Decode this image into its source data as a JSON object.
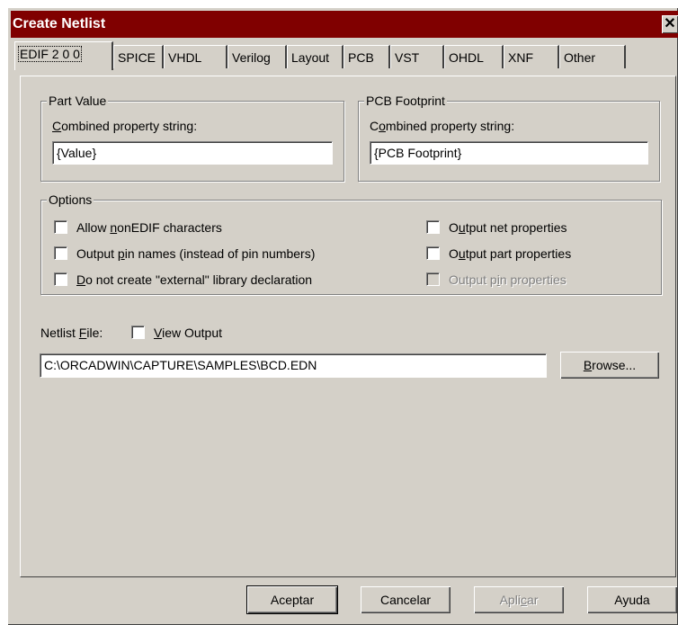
{
  "window": {
    "title": "Create Netlist",
    "close_glyph": "✕"
  },
  "tabs": [
    {
      "label": "EDIF 2 0 0",
      "active": true
    },
    {
      "label": "SPICE"
    },
    {
      "label": "VHDL"
    },
    {
      "label": "Verilog"
    },
    {
      "label": "Layout"
    },
    {
      "label": "PCB"
    },
    {
      "label": "VST"
    },
    {
      "label": "OHDL"
    },
    {
      "label": "XNF"
    },
    {
      "label": "Other"
    }
  ],
  "part_value": {
    "group_label": "Part Value",
    "field_label_u": "C",
    "field_label_rest": "ombined property string:",
    "value": "{Value}"
  },
  "pcb_footprint": {
    "group_label": "PCB Footprint",
    "field_label_pre": "C",
    "field_label_u": "o",
    "field_label_rest": "mbined property string:",
    "value": "{PCB Footprint}"
  },
  "options": {
    "group_label": "Options",
    "allow_nonedif": {
      "pre": "Allow ",
      "u": "n",
      "rest": "onEDIF characters"
    },
    "output_pin_names": {
      "pre": "Output ",
      "u": "p",
      "rest": "in names (instead of pin numbers)"
    },
    "no_external": {
      "pre": "",
      "u": "D",
      "rest": "o not create \"external\" library declaration"
    },
    "output_net": {
      "pre": "O",
      "u": "u",
      "rest": "tput net properties"
    },
    "output_part": {
      "pre": "O",
      "u": "u",
      "rest": "tput part properties"
    },
    "output_pin_props": {
      "pre": "Output p",
      "u": "i",
      "rest": "n properties",
      "disabled": true
    }
  },
  "netlist": {
    "label_pre": "Netlist ",
    "label_u": "F",
    "label_rest": "ile:",
    "view_output_u": "V",
    "view_output_rest": "iew Output",
    "path": "C:\\ORCADWIN\\CAPTURE\\SAMPLES\\BCD.EDN",
    "browse_u": "B",
    "browse_rest": "rowse..."
  },
  "buttons": {
    "ok": "Aceptar",
    "cancel": "Cancelar",
    "apply_pre": "Apli",
    "apply_u": "c",
    "apply_rest": "ar",
    "help": "Ayuda"
  },
  "colors": {
    "titlebar": "#800000",
    "face": "#d4d0c8"
  }
}
